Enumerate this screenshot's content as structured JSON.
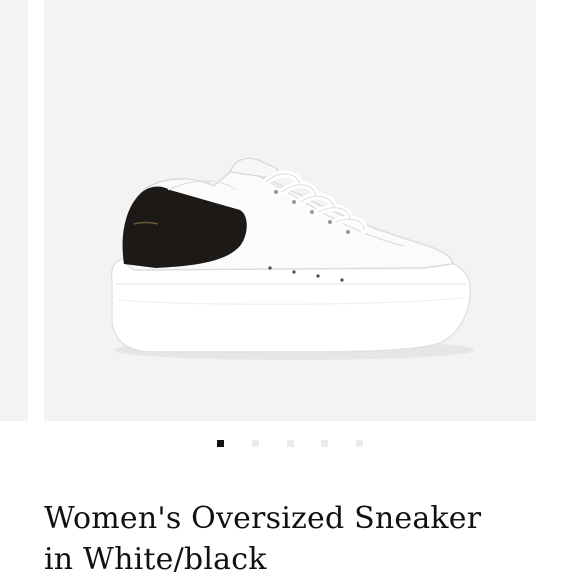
{
  "gallery": {
    "slide_count": 5,
    "active_index": 0,
    "image_subject": "white leather oversized sneaker with black suede heel tab",
    "colors": {
      "background": "#f3f3f3",
      "shoe": "#fbfbfb",
      "heel_tab": "#1d1917",
      "active_dot": "#111111",
      "inactive_dot": "#ececec"
    }
  },
  "product": {
    "title_line_1": "Women's Oversized Sneaker",
    "title_line_2": "in White/black"
  }
}
